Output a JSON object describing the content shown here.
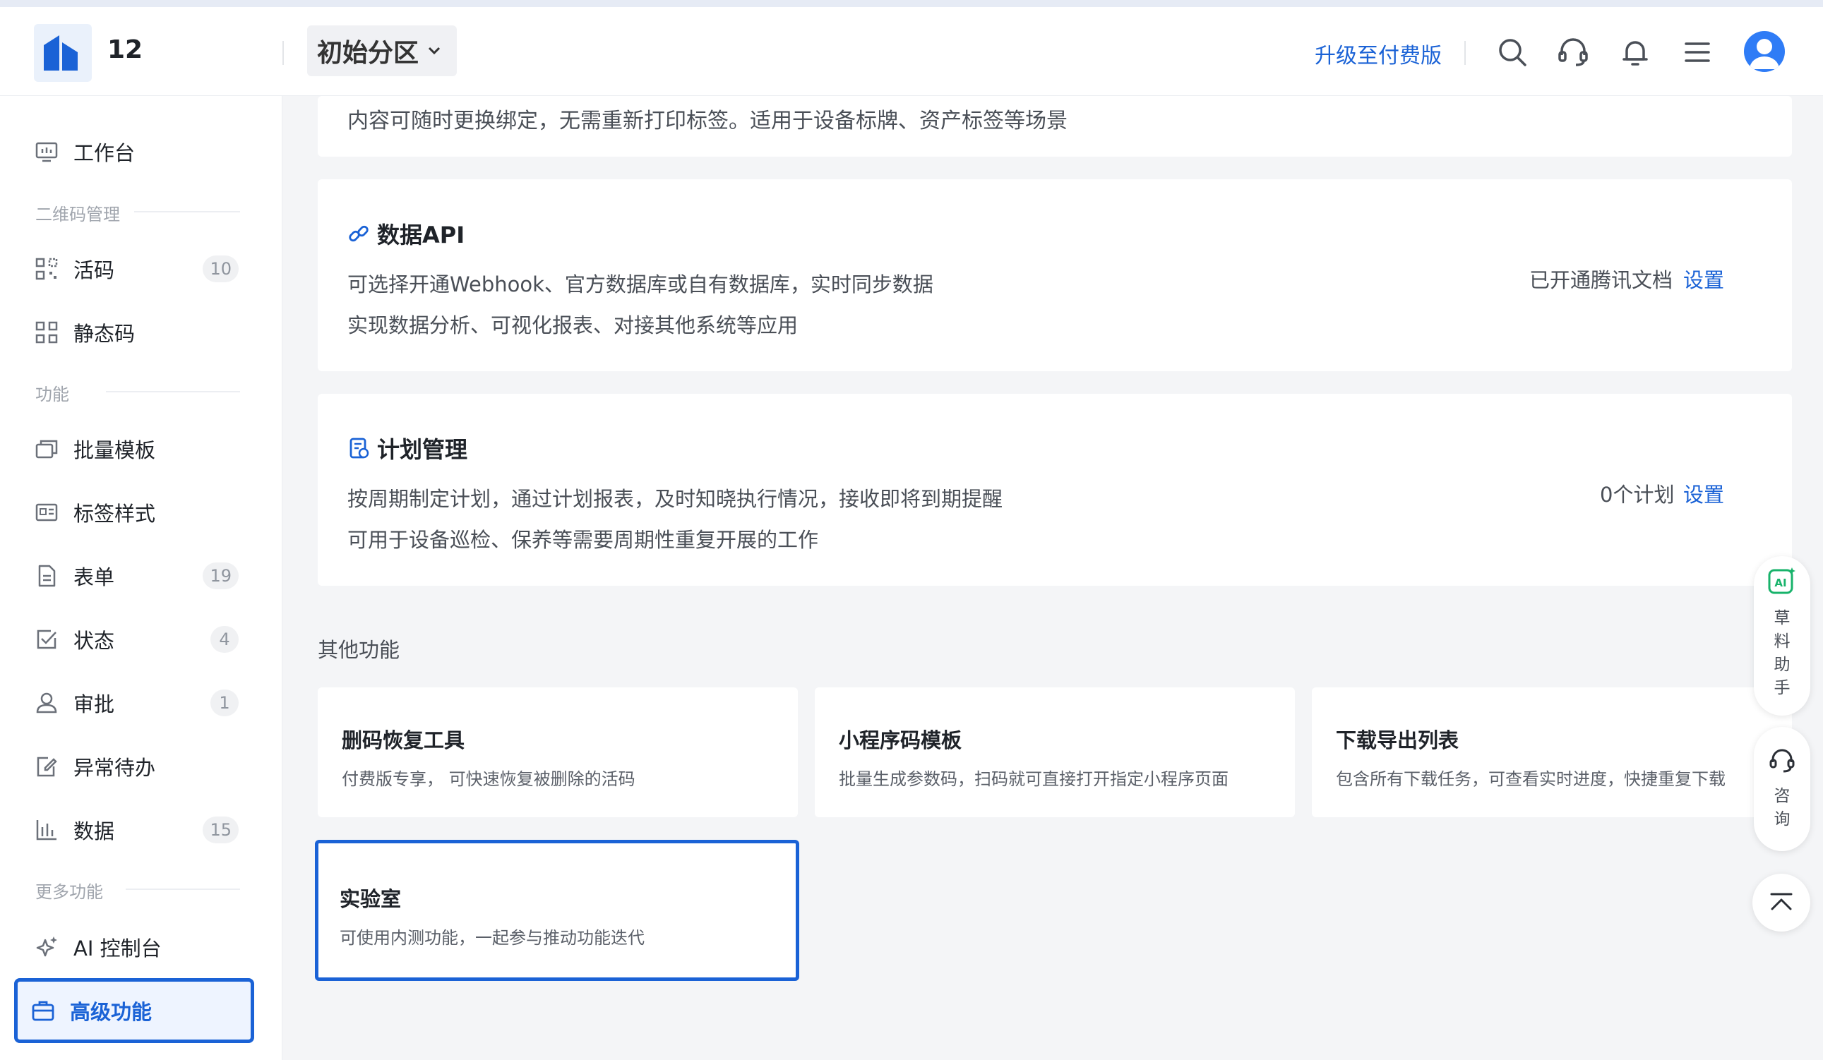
{
  "header": {
    "org_name": "12",
    "partition": "初始分区",
    "upgrade": "升级至付费版",
    "icons": [
      "search-icon",
      "headset-icon",
      "bell-icon",
      "menu-icon",
      "avatar"
    ]
  },
  "sidebar": {
    "workbench": "工作台",
    "sec_qrcode": "二维码管理",
    "live_code": "活码",
    "live_code_count": "10",
    "static_code": "静态码",
    "sec_function": "功能",
    "batch_template": "批量模板",
    "label_style": "标签样式",
    "form": "表单",
    "form_count": "19",
    "status": "状态",
    "status_count": "4",
    "approval": "审批",
    "approval_count": "1",
    "exception": "异常待办",
    "data": "数据",
    "data_count": "15",
    "sec_more": "更多功能",
    "ai_console": "AI 控制台",
    "advanced": "高级功能"
  },
  "main": {
    "top_card_desc": "内容可随时更换绑定，无需重新打印标签。适用于设备标牌、资产标签等场景",
    "api_card": {
      "title": "数据API",
      "line1": "可选择开通Webhook、官方数据库或自有数据库，实时同步数据",
      "line2": "实现数据分析、可视化报表、对接其他系统等应用",
      "status": "已开通腾讯文档",
      "action": "设置"
    },
    "plan_card": {
      "title": "计划管理",
      "line1": "按周期制定计划，通过计划报表，及时知晓执行情况，接收即将到期提醒",
      "line2": "可用于设备巡检、保养等需要周期性重复开展的工作",
      "status": "0个计划",
      "action": "设置"
    },
    "other_title": "其他功能",
    "tiles": [
      {
        "title": "删码恢复工具",
        "desc": "付费版专享， 可快速恢复被删除的活码"
      },
      {
        "title": "小程序码模板",
        "desc": "批量生成参数码，扫码就可直接打开指定小程序页面"
      },
      {
        "title": "下载导出列表",
        "desc": "包含所有下载任务，可查看实时进度，快捷重复下载"
      },
      {
        "title": "实验室",
        "desc": "可使用内测功能，一起参与推动功能迭代"
      }
    ]
  },
  "float": {
    "ai_badge": "AI",
    "assistant_chars": [
      "草",
      "料",
      "助",
      "手"
    ],
    "consult_chars": [
      "咨",
      "询"
    ]
  },
  "colors": {
    "accent": "#1a62d6",
    "background": "#f4f5f7",
    "badge_bg": "#f0f1f3"
  }
}
